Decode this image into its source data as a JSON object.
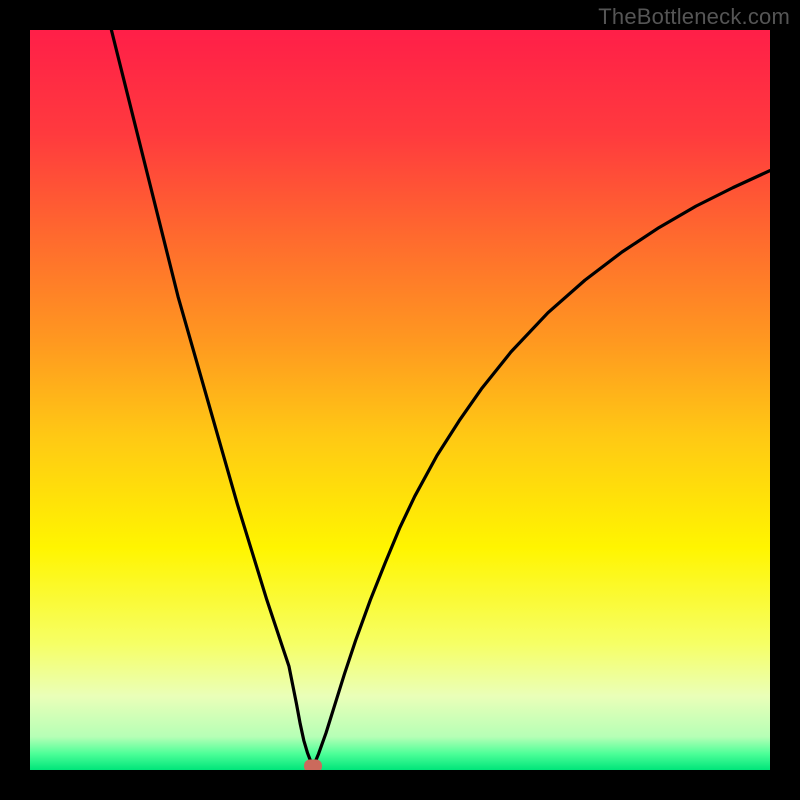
{
  "watermark": "TheBottleneck.com",
  "chart_data": {
    "type": "line",
    "title": "",
    "xlabel": "",
    "ylabel": "",
    "xlim": [
      0,
      100
    ],
    "ylim": [
      0,
      100
    ],
    "grid": false,
    "series": [
      {
        "name": "curve",
        "x": [
          11,
          12,
          14,
          16,
          18,
          20,
          22,
          24,
          26,
          28,
          30,
          32,
          34,
          35,
          35.5,
          36,
          36.5,
          37,
          37.5,
          38,
          38.2,
          38.5,
          39,
          40,
          41,
          42.5,
          44,
          46,
          48,
          50,
          52,
          55,
          58,
          61,
          65,
          70,
          75,
          80,
          85,
          90,
          95,
          100
        ],
        "y": [
          100,
          96,
          88,
          80,
          72,
          64,
          57,
          50,
          43,
          36,
          29.5,
          23,
          17,
          14,
          11.5,
          9,
          6.3,
          4.0,
          2.3,
          1.0,
          0.6,
          1.0,
          2.2,
          5.0,
          8.2,
          13.0,
          17.5,
          23.0,
          28.0,
          32.8,
          37.0,
          42.5,
          47.2,
          51.5,
          56.5,
          61.8,
          66.2,
          70.0,
          73.3,
          76.2,
          78.7,
          81.0
        ]
      }
    ],
    "marker": {
      "x": 38.2,
      "y": 0.6,
      "color": "#cb6a5c"
    },
    "gradient_stops": [
      {
        "pos": 0.0,
        "color": "#ff1f48"
      },
      {
        "pos": 0.14,
        "color": "#ff3a3e"
      },
      {
        "pos": 0.28,
        "color": "#ff6a2e"
      },
      {
        "pos": 0.42,
        "color": "#ff9820"
      },
      {
        "pos": 0.55,
        "color": "#ffc914"
      },
      {
        "pos": 0.7,
        "color": "#fff500"
      },
      {
        "pos": 0.83,
        "color": "#f6ff66"
      },
      {
        "pos": 0.9,
        "color": "#eaffb8"
      },
      {
        "pos": 0.955,
        "color": "#b6ffb6"
      },
      {
        "pos": 0.978,
        "color": "#4dff98"
      },
      {
        "pos": 1.0,
        "color": "#00e57a"
      }
    ]
  }
}
